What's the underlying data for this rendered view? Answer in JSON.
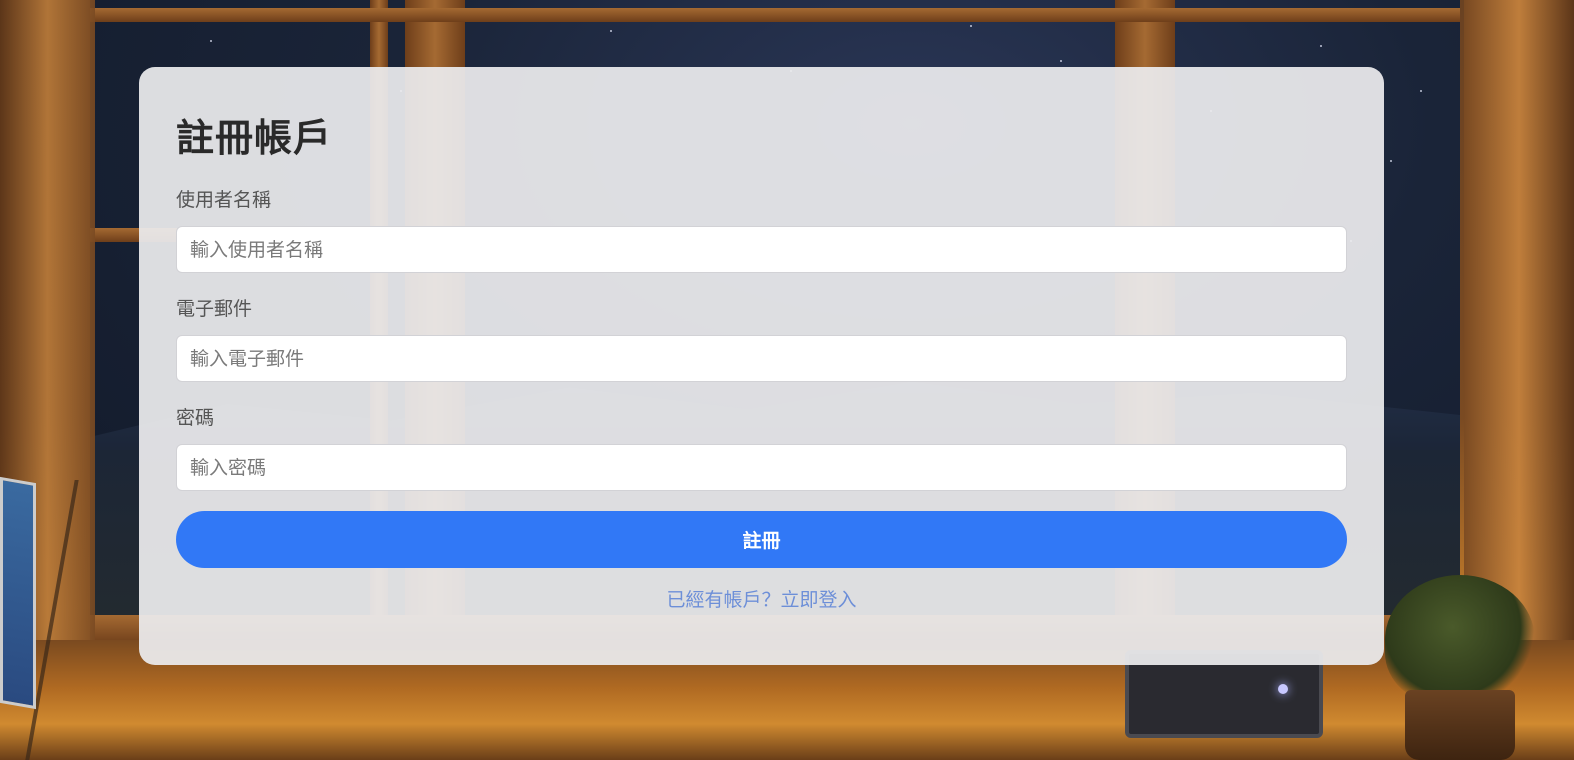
{
  "form": {
    "title": "註冊帳戶",
    "username": {
      "label": "使用者名稱",
      "placeholder": "輸入使用者名稱",
      "value": ""
    },
    "email": {
      "label": "電子郵件",
      "placeholder": "輸入電子郵件",
      "value": ""
    },
    "password": {
      "label": "密碼",
      "placeholder": "輸入密碼",
      "value": ""
    },
    "submit_label": "註冊",
    "login_link": "已經有帳戶？立即登入"
  },
  "colors": {
    "primary_button": "#3178f6",
    "link": "#6d8fd8",
    "card_background": "#ececee"
  }
}
